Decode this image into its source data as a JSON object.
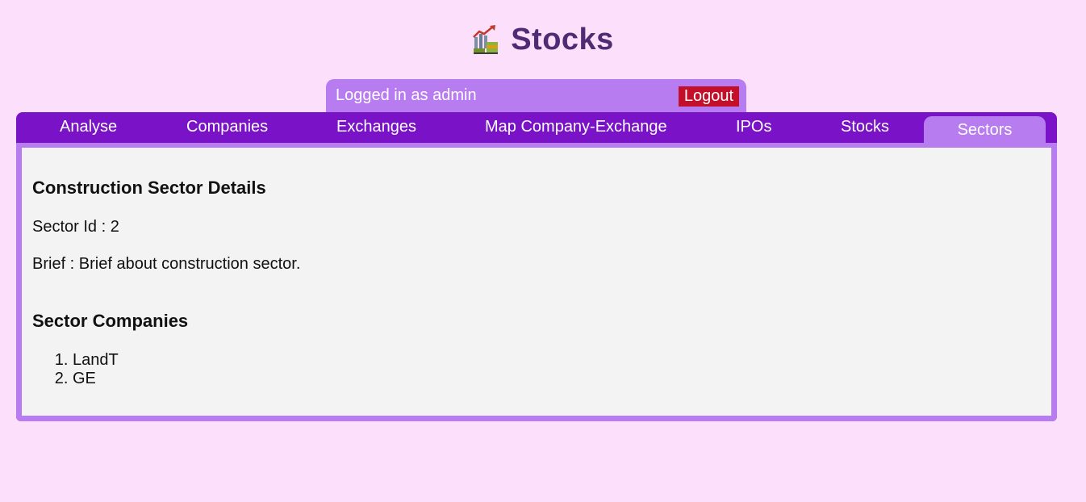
{
  "app": {
    "title": "Stocks",
    "logo_icon": "stock-chart-coins-icon"
  },
  "session": {
    "text": "Logged in as admin",
    "logout_label": "Logout"
  },
  "nav": {
    "items": [
      {
        "label": "Analyse",
        "active": false
      },
      {
        "label": "Companies",
        "active": false
      },
      {
        "label": "Exchanges",
        "active": false
      },
      {
        "label": "Map Company-Exchange",
        "active": false
      },
      {
        "label": "IPOs",
        "active": false
      },
      {
        "label": "Stocks",
        "active": false
      },
      {
        "label": "Sectors",
        "active": true
      }
    ]
  },
  "sector": {
    "heading": "Construction Sector Details",
    "id_line": "Sector Id : 2",
    "brief_line": "Brief : Brief about construction sector.",
    "companies_heading": "Sector Companies",
    "companies": [
      "LandT",
      "GE"
    ]
  },
  "colors": {
    "page_bg": "#fbdffb",
    "title": "#4f2b74",
    "nav_bg": "#7a12c7",
    "accent": "#b87cf1",
    "logout": "#c40f2b",
    "content_bg": "#f3f3f3"
  }
}
